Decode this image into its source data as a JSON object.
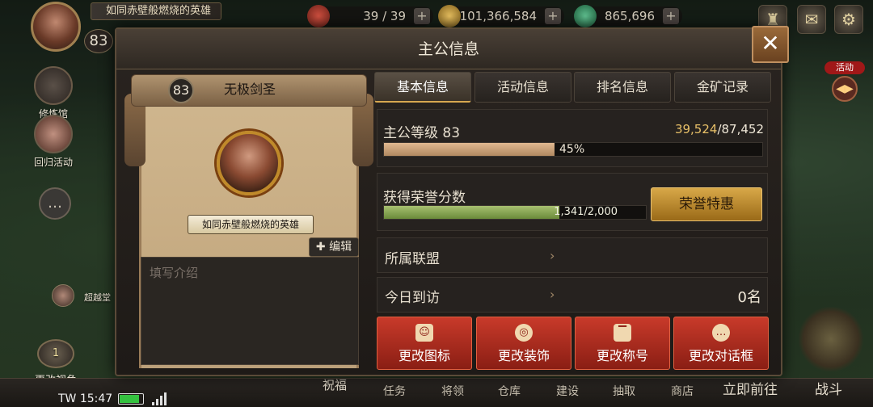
{
  "hud": {
    "hero_level": "83",
    "hero_title": "如同赤壁般燃烧的英雄",
    "resources": [
      {
        "icon": "scroll-icon",
        "value": "39 / 39",
        "color": "#b04030"
      },
      {
        "icon": "coin-icon",
        "value": "101,366,584",
        "color": "#c8a040"
      },
      {
        "icon": "jade-icon",
        "value": "865,696",
        "color": "#40a070"
      }
    ],
    "right_buttons": [
      "bell-icon",
      "mail-icon",
      "settings-icon"
    ]
  },
  "left_side": {
    "cultivation_label": "修炼馆",
    "return_label": "回归活动",
    "chat_icon": "chat-icon",
    "mini_label": "超越堂",
    "view_level": "1",
    "view_label": "更改视角"
  },
  "right_side": {
    "activity_label": "活动"
  },
  "bottom": {
    "time": "TW 15:47",
    "blessing": "祝福",
    "items": [
      "任务",
      "将领",
      "仓库",
      "建设",
      "抽取",
      "商店"
    ],
    "go_label": "立即前往",
    "battle_label": "战斗"
  },
  "dialog": {
    "title": "主公信息",
    "close_icon": "close-icon",
    "profile": {
      "level": "83",
      "name": "无极剑圣",
      "title_plate": "如同赤壁般燃烧的英雄",
      "edit_label": "✚ 编辑",
      "intro_placeholder": "填写介绍"
    },
    "tabs": [
      "基本信息",
      "活动信息",
      "排名信息",
      "金矿记录"
    ],
    "lord_level_label": "主公等级 83",
    "xp_current": "39,524",
    "xp_total": "/87,452",
    "xp_percent": "45%",
    "xp_fraction": 0.45,
    "honor_label": "获得荣誉分数",
    "honor_value": "1,341/2,000",
    "honor_fraction": 0.6705,
    "honor_button": "荣誉特惠",
    "alliance_label": "所属联盟",
    "visit_label": "今日到访",
    "visit_count": "0名",
    "actions": [
      {
        "label": "更改图标",
        "icon": "portrait-icon"
      },
      {
        "label": "更改装饰",
        "icon": "frame-icon"
      },
      {
        "label": "更改称号",
        "icon": "title-icon"
      },
      {
        "label": "更改对话框",
        "icon": "speech-bubble-icon"
      }
    ]
  }
}
